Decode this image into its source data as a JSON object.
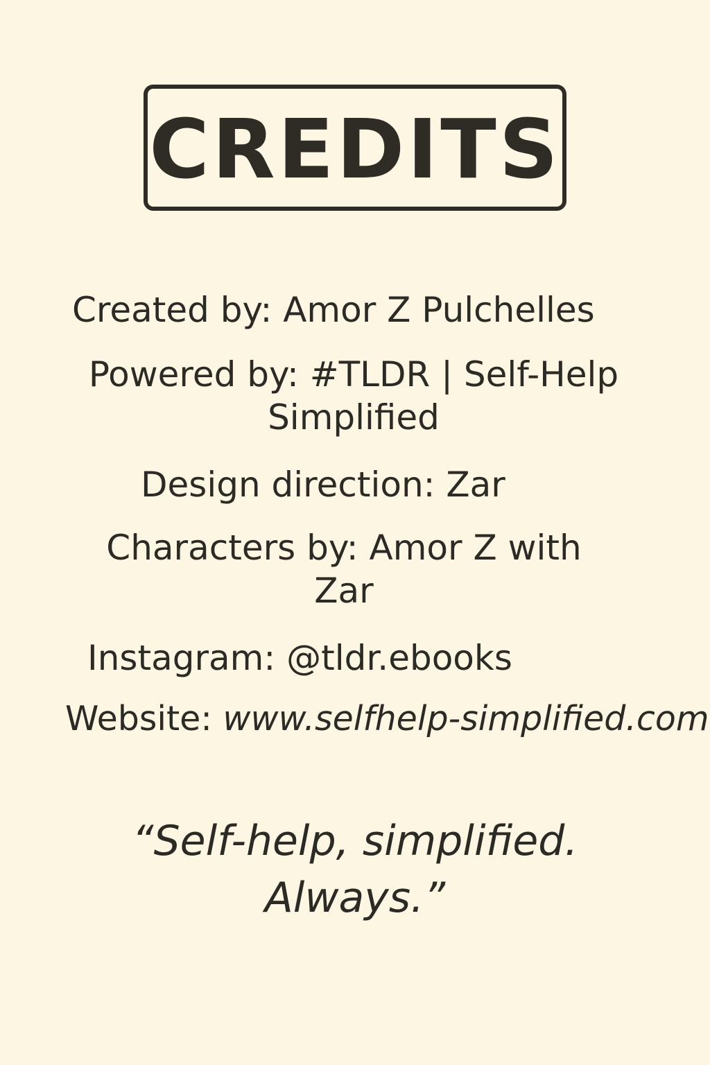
{
  "title": "CREDITS",
  "credits": {
    "created_by": "Created by: Amor Z Pulchelles",
    "powered_by_line1": "Powered by: #TLDR | Self-Help",
    "powered_by_line2": "Simplified",
    "design_direction": "Design direction: Zar",
    "characters_line1": "Characters by: Amor Z with",
    "characters_line2": "Zar",
    "instagram": "Instagram: @tldr.ebooks",
    "website_label": "Website:",
    "website_value": "www.selfhelp-simplified.com"
  },
  "quote": {
    "line1": "“Self-help, simplified.",
    "line2": "Always.”"
  },
  "colors": {
    "background": "#fdf6e3",
    "text": "#2b2a24"
  }
}
